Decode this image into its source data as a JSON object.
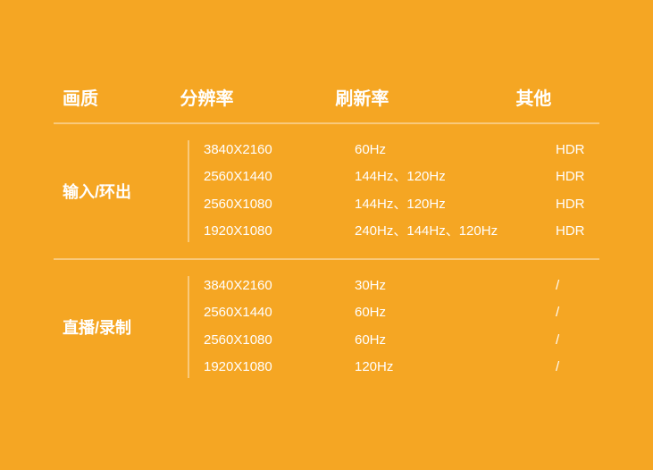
{
  "header": {
    "col_quality": "画质",
    "col_resolution": "分辨率",
    "col_refresh": "刷新率",
    "col_other": "其他"
  },
  "sections": [
    {
      "id": "input-output",
      "quality_label": "输入/环出",
      "rows": [
        {
          "resolution": "3840X2160",
          "refresh": "60Hz",
          "other": "HDR"
        },
        {
          "resolution": "2560X1440",
          "refresh": "144Hz、120Hz",
          "other": "HDR"
        },
        {
          "resolution": "2560X1080",
          "refresh": "144Hz、120Hz",
          "other": "HDR"
        },
        {
          "resolution": "1920X1080",
          "refresh": "240Hz、144Hz、120Hz",
          "other": "HDR"
        }
      ]
    },
    {
      "id": "live-record",
      "quality_label": "直播/录制",
      "rows": [
        {
          "resolution": "3840X2160",
          "refresh": "30Hz",
          "other": "/"
        },
        {
          "resolution": "2560X1440",
          "refresh": "60Hz",
          "other": "/"
        },
        {
          "resolution": "2560X1080",
          "refresh": "60Hz",
          "other": "/"
        },
        {
          "resolution": "1920X1080",
          "refresh": "120Hz",
          "other": "/"
        }
      ]
    }
  ],
  "colors": {
    "background": "#f5a623",
    "text": "#ffffff",
    "divider": "rgba(255,255,255,0.4)"
  }
}
